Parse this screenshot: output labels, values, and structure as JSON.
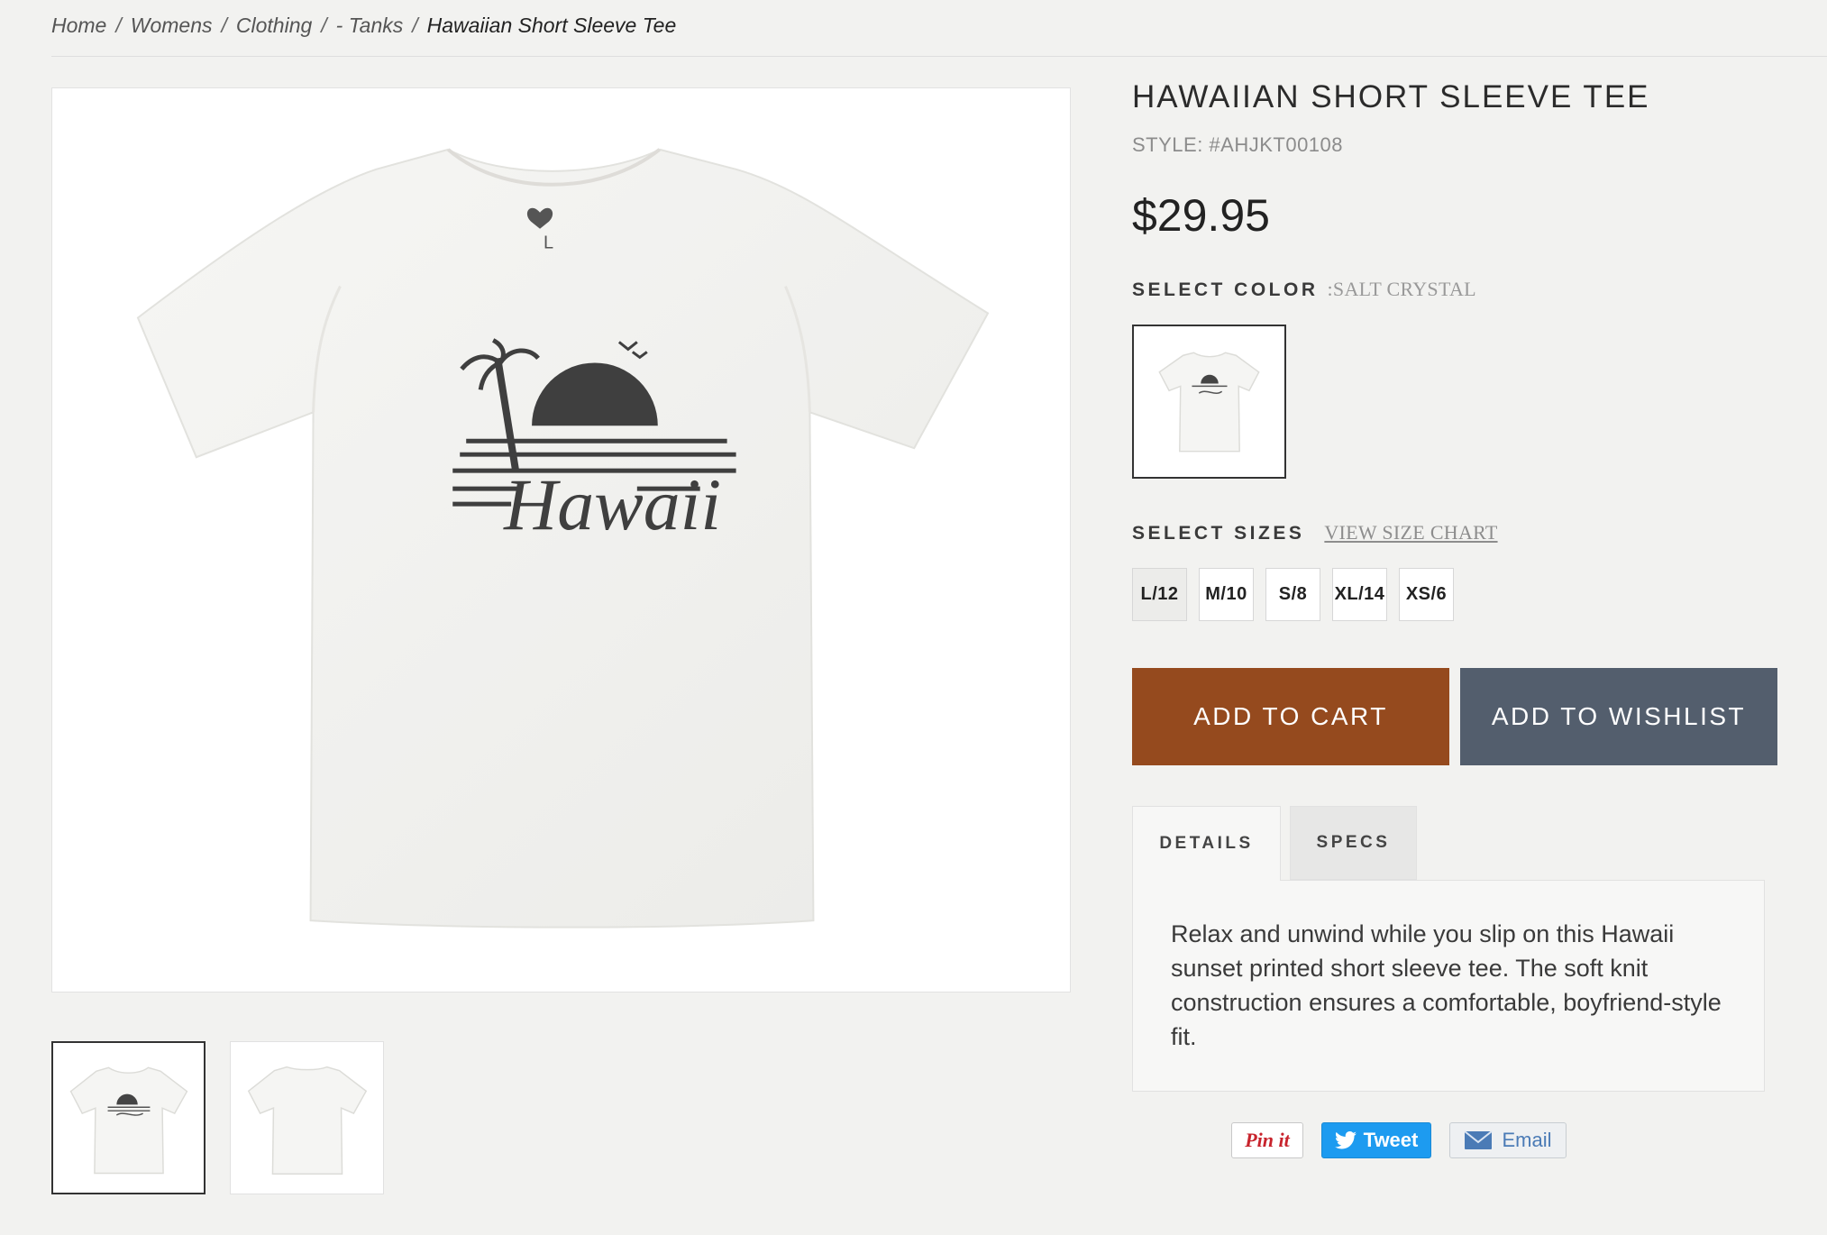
{
  "breadcrumb": {
    "items": [
      "Home",
      "Womens",
      "Clothing",
      "- Tanks"
    ],
    "separator": "/",
    "current": "Hawaiian Short Sleeve Tee"
  },
  "product": {
    "title": "HAWAIIAN SHORT SLEEVE TEE",
    "style": "STYLE: #AHJKT00108",
    "price": "$29.95",
    "print_text": "Hawaii",
    "tag_size": "L"
  },
  "color": {
    "label": "SELECT COLOR",
    "value": ":SALT CRYSTAL"
  },
  "sizes": {
    "label": "SELECT SIZES",
    "chart_link": "VIEW SIZE CHART",
    "options": [
      "L/12",
      "M/10",
      "S/8",
      "XL/14",
      "XS/6"
    ],
    "selected": "L/12"
  },
  "actions": {
    "add_to_cart": "ADD TO CART",
    "add_to_wishlist": "ADD TO WISHLIST"
  },
  "tabs": {
    "details_label": "DETAILS",
    "specs_label": "SPECS",
    "active": "DETAILS",
    "details_text": "Relax and unwind while you slip on this Hawaii sunset printed short sleeve tee. The soft knit construction ensures a comfortable, boyfriend-style fit."
  },
  "share": {
    "pin_label": "Pin it",
    "tweet_label": "Tweet",
    "email_label": "Email"
  },
  "colors": {
    "cart_button": "#954a1e",
    "wishlist_button": "#535e6d",
    "background": "#f2f2f0",
    "tweet": "#1d9bf0"
  }
}
